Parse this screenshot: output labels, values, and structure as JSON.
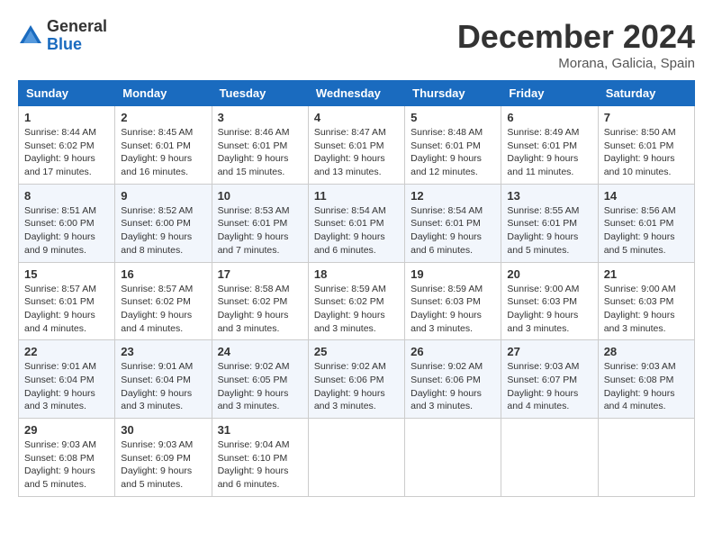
{
  "logo": {
    "general": "General",
    "blue": "Blue"
  },
  "title": "December 2024",
  "location": "Morana, Galicia, Spain",
  "headers": [
    "Sunday",
    "Monday",
    "Tuesday",
    "Wednesday",
    "Thursday",
    "Friday",
    "Saturday"
  ],
  "weeks": [
    [
      {
        "day": "1",
        "sunrise": "Sunrise: 8:44 AM",
        "sunset": "Sunset: 6:02 PM",
        "daylight": "Daylight: 9 hours and 17 minutes."
      },
      {
        "day": "2",
        "sunrise": "Sunrise: 8:45 AM",
        "sunset": "Sunset: 6:01 PM",
        "daylight": "Daylight: 9 hours and 16 minutes."
      },
      {
        "day": "3",
        "sunrise": "Sunrise: 8:46 AM",
        "sunset": "Sunset: 6:01 PM",
        "daylight": "Daylight: 9 hours and 15 minutes."
      },
      {
        "day": "4",
        "sunrise": "Sunrise: 8:47 AM",
        "sunset": "Sunset: 6:01 PM",
        "daylight": "Daylight: 9 hours and 13 minutes."
      },
      {
        "day": "5",
        "sunrise": "Sunrise: 8:48 AM",
        "sunset": "Sunset: 6:01 PM",
        "daylight": "Daylight: 9 hours and 12 minutes."
      },
      {
        "day": "6",
        "sunrise": "Sunrise: 8:49 AM",
        "sunset": "Sunset: 6:01 PM",
        "daylight": "Daylight: 9 hours and 11 minutes."
      },
      {
        "day": "7",
        "sunrise": "Sunrise: 8:50 AM",
        "sunset": "Sunset: 6:01 PM",
        "daylight": "Daylight: 9 hours and 10 minutes."
      }
    ],
    [
      {
        "day": "8",
        "sunrise": "Sunrise: 8:51 AM",
        "sunset": "Sunset: 6:00 PM",
        "daylight": "Daylight: 9 hours and 9 minutes."
      },
      {
        "day": "9",
        "sunrise": "Sunrise: 8:52 AM",
        "sunset": "Sunset: 6:00 PM",
        "daylight": "Daylight: 9 hours and 8 minutes."
      },
      {
        "day": "10",
        "sunrise": "Sunrise: 8:53 AM",
        "sunset": "Sunset: 6:01 PM",
        "daylight": "Daylight: 9 hours and 7 minutes."
      },
      {
        "day": "11",
        "sunrise": "Sunrise: 8:54 AM",
        "sunset": "Sunset: 6:01 PM",
        "daylight": "Daylight: 9 hours and 6 minutes."
      },
      {
        "day": "12",
        "sunrise": "Sunrise: 8:54 AM",
        "sunset": "Sunset: 6:01 PM",
        "daylight": "Daylight: 9 hours and 6 minutes."
      },
      {
        "day": "13",
        "sunrise": "Sunrise: 8:55 AM",
        "sunset": "Sunset: 6:01 PM",
        "daylight": "Daylight: 9 hours and 5 minutes."
      },
      {
        "day": "14",
        "sunrise": "Sunrise: 8:56 AM",
        "sunset": "Sunset: 6:01 PM",
        "daylight": "Daylight: 9 hours and 5 minutes."
      }
    ],
    [
      {
        "day": "15",
        "sunrise": "Sunrise: 8:57 AM",
        "sunset": "Sunset: 6:01 PM",
        "daylight": "Daylight: 9 hours and 4 minutes."
      },
      {
        "day": "16",
        "sunrise": "Sunrise: 8:57 AM",
        "sunset": "Sunset: 6:02 PM",
        "daylight": "Daylight: 9 hours and 4 minutes."
      },
      {
        "day": "17",
        "sunrise": "Sunrise: 8:58 AM",
        "sunset": "Sunset: 6:02 PM",
        "daylight": "Daylight: 9 hours and 3 minutes."
      },
      {
        "day": "18",
        "sunrise": "Sunrise: 8:59 AM",
        "sunset": "Sunset: 6:02 PM",
        "daylight": "Daylight: 9 hours and 3 minutes."
      },
      {
        "day": "19",
        "sunrise": "Sunrise: 8:59 AM",
        "sunset": "Sunset: 6:03 PM",
        "daylight": "Daylight: 9 hours and 3 minutes."
      },
      {
        "day": "20",
        "sunrise": "Sunrise: 9:00 AM",
        "sunset": "Sunset: 6:03 PM",
        "daylight": "Daylight: 9 hours and 3 minutes."
      },
      {
        "day": "21",
        "sunrise": "Sunrise: 9:00 AM",
        "sunset": "Sunset: 6:03 PM",
        "daylight": "Daylight: 9 hours and 3 minutes."
      }
    ],
    [
      {
        "day": "22",
        "sunrise": "Sunrise: 9:01 AM",
        "sunset": "Sunset: 6:04 PM",
        "daylight": "Daylight: 9 hours and 3 minutes."
      },
      {
        "day": "23",
        "sunrise": "Sunrise: 9:01 AM",
        "sunset": "Sunset: 6:04 PM",
        "daylight": "Daylight: 9 hours and 3 minutes."
      },
      {
        "day": "24",
        "sunrise": "Sunrise: 9:02 AM",
        "sunset": "Sunset: 6:05 PM",
        "daylight": "Daylight: 9 hours and 3 minutes."
      },
      {
        "day": "25",
        "sunrise": "Sunrise: 9:02 AM",
        "sunset": "Sunset: 6:06 PM",
        "daylight": "Daylight: 9 hours and 3 minutes."
      },
      {
        "day": "26",
        "sunrise": "Sunrise: 9:02 AM",
        "sunset": "Sunset: 6:06 PM",
        "daylight": "Daylight: 9 hours and 3 minutes."
      },
      {
        "day": "27",
        "sunrise": "Sunrise: 9:03 AM",
        "sunset": "Sunset: 6:07 PM",
        "daylight": "Daylight: 9 hours and 4 minutes."
      },
      {
        "day": "28",
        "sunrise": "Sunrise: 9:03 AM",
        "sunset": "Sunset: 6:08 PM",
        "daylight": "Daylight: 9 hours and 4 minutes."
      }
    ],
    [
      {
        "day": "29",
        "sunrise": "Sunrise: 9:03 AM",
        "sunset": "Sunset: 6:08 PM",
        "daylight": "Daylight: 9 hours and 5 minutes."
      },
      {
        "day": "30",
        "sunrise": "Sunrise: 9:03 AM",
        "sunset": "Sunset: 6:09 PM",
        "daylight": "Daylight: 9 hours and 5 minutes."
      },
      {
        "day": "31",
        "sunrise": "Sunrise: 9:04 AM",
        "sunset": "Sunset: 6:10 PM",
        "daylight": "Daylight: 9 hours and 6 minutes."
      },
      null,
      null,
      null,
      null
    ]
  ]
}
